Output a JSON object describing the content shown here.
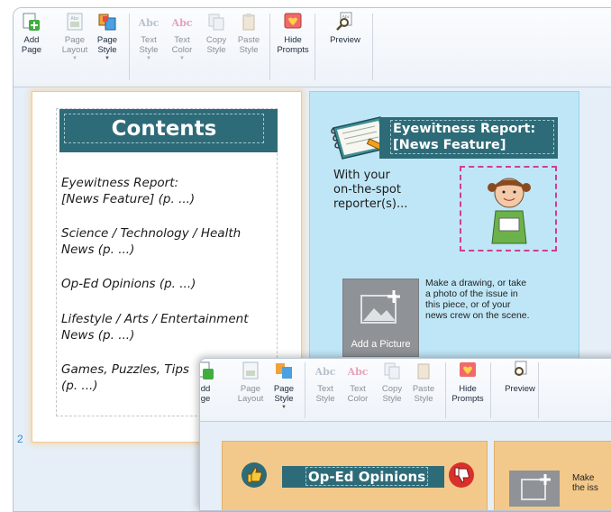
{
  "ribbon": {
    "buttons": [
      {
        "label": "Add\nPage",
        "icon": "add-page-icon",
        "enabled": true
      },
      {
        "label": "Page\nLayout",
        "icon": "page-layout-icon",
        "enabled": false
      },
      {
        "label": "Page\nStyle",
        "icon": "page-style-icon",
        "enabled": true
      },
      {
        "label": "Text\nStyle",
        "icon": "text-style-icon",
        "enabled": false
      },
      {
        "label": "Text\nColor",
        "icon": "text-color-icon",
        "enabled": false
      },
      {
        "label": "Copy\nStyle",
        "icon": "copy-style-icon",
        "enabled": false
      },
      {
        "label": "Paste\nStyle",
        "icon": "paste-style-icon",
        "enabled": false
      },
      {
        "label": "Hide\nPrompts",
        "icon": "hide-prompts-icon",
        "enabled": true
      },
      {
        "label": "Preview",
        "icon": "preview-icon",
        "enabled": true
      }
    ]
  },
  "left_page": {
    "title": "Contents",
    "toc": [
      "Eyewitness Report:\n[News Feature] (p. ...)",
      "Science / Technology / Health\nNews (p. ...)",
      "Op-Ed Opinions (p. ...)",
      "Lifestyle / Arts / Entertainment\nNews (p. ...)",
      "Games, Puzzles, Tips\n(p. ...)"
    ],
    "page_number": "2"
  },
  "right_page": {
    "title": "Eyewitness Report:\n[News Feature]",
    "byline": "With your\non-the-spot\nreporter(s)...",
    "picture_button": "Add a Picture",
    "picture_prompt": "Make a drawing, or take\na photo of the issue in\nthis piece, or of your\nnews crew on the scene."
  },
  "popup": {
    "buttons": [
      {
        "label": "dd\nge",
        "icon": "add-page-icon",
        "enabled": true
      },
      {
        "label": "Page\nLayout",
        "icon": "page-layout-icon",
        "enabled": false
      },
      {
        "label": "Page\nStyle",
        "icon": "page-style-icon",
        "enabled": true
      },
      {
        "label": "Text\nStyle",
        "icon": "text-style-icon",
        "enabled": false
      },
      {
        "label": "Text\nColor",
        "icon": "text-color-icon",
        "enabled": false
      },
      {
        "label": "Copy\nStyle",
        "icon": "copy-style-icon",
        "enabled": false
      },
      {
        "label": "Paste\nStyle",
        "icon": "paste-style-icon",
        "enabled": false
      },
      {
        "label": "Hide\nPrompts",
        "icon": "hide-prompts-icon",
        "enabled": true
      },
      {
        "label": "Preview",
        "icon": "preview-icon",
        "enabled": true
      }
    ],
    "op_title": "Op-Ed Opinions",
    "prompt_partial": "Make\nthe iss"
  },
  "colors": {
    "title_bar": "#2e6b78",
    "right_page_bg": "#bfe6f6",
    "op_page_bg": "#f2c98a",
    "prompt_frame": "#d23d8c",
    "page_number": "#2d8fd8"
  }
}
